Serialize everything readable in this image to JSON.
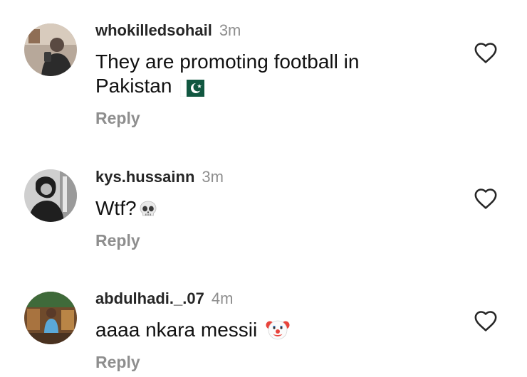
{
  "comments": [
    {
      "username": "whokilledsohail",
      "time": "3m",
      "text": "They are promoting football in Pakistan",
      "emoji": "pakistan-flag-icon",
      "reply_label": "Reply"
    },
    {
      "username": "kys.hussainn",
      "time": "3m",
      "text": "Wtf?",
      "emoji": "skull-icon",
      "reply_label": "Reply"
    },
    {
      "username": "abdulhadi._.07",
      "time": "4m",
      "text": "aaaa nkara messii",
      "emoji": "clown-face-icon",
      "reply_label": "Reply"
    }
  ],
  "colors": {
    "text_primary": "#262626",
    "text_secondary": "#8e8e8e",
    "heart_outline": "#262626"
  }
}
